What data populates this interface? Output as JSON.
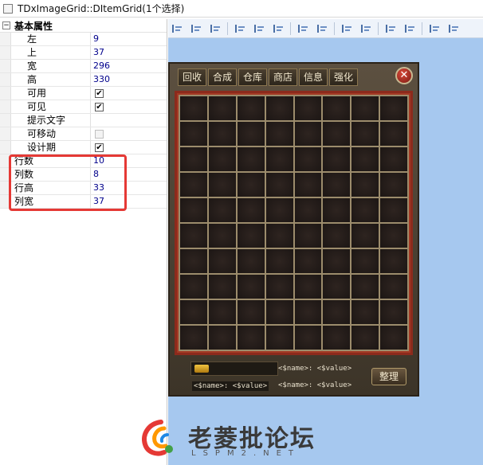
{
  "window": {
    "title": "TDxImageGrid::DItemGrid(1个选择)"
  },
  "propgrid": {
    "category": "基本属性",
    "toggle": "−",
    "rows": [
      {
        "name": "左",
        "value": "9"
      },
      {
        "name": "上",
        "value": "37"
      },
      {
        "name": "宽",
        "value": "296"
      },
      {
        "name": "高",
        "value": "330"
      },
      {
        "name": "可用",
        "checked": true
      },
      {
        "name": "可见",
        "checked": true
      },
      {
        "name": "提示文字",
        "value": ""
      },
      {
        "name": "可移动",
        "checked": false
      },
      {
        "name": "设计期",
        "checked": true
      },
      {
        "name": "行数",
        "value": "10"
      },
      {
        "name": "列数",
        "value": "8"
      },
      {
        "name": "行高",
        "value": "33"
      },
      {
        "name": "列宽",
        "value": "37"
      }
    ],
    "check_mark": "✔"
  },
  "game": {
    "tabs": [
      "回收",
      "合成",
      "仓库",
      "商店",
      "信息",
      "强化"
    ],
    "close_glyph": "✕",
    "grid": {
      "rows": 10,
      "cols": 8
    },
    "label_right": "<$name>: <$value>",
    "label_left": "<$name>: <$value>",
    "label_bottom": "<$name>: <$value>",
    "sort_button": "整理"
  },
  "watermark": {
    "text": "老菱批论坛",
    "sub": "LSPM2.NET"
  },
  "colors": {
    "designer_bg": "#a6c8ef",
    "highlight": "#e53935"
  }
}
